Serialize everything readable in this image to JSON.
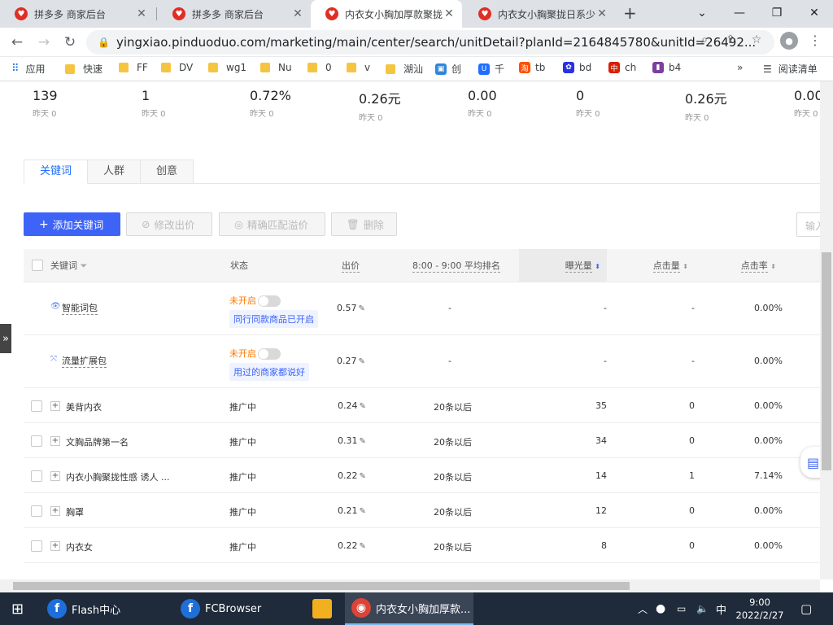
{
  "browser": {
    "tabs": [
      {
        "title": "拼多多 商家后台",
        "active": false
      },
      {
        "title": "拼多多 商家后台",
        "active": false
      },
      {
        "title": "内衣女小胸加厚款聚拢",
        "active": true
      },
      {
        "title": "内衣女小胸聚拢日系少",
        "active": false
      }
    ],
    "url": "yingxiao.pinduoduo.com/marketing/main/center/search/unitDetail?planId=2164845780&unitId=26492...",
    "bookmarks": [
      "应用",
      "快速",
      "FF",
      "DV",
      "wg1",
      "Nu",
      "0",
      "v",
      "湖汕",
      "创",
      "千",
      "tb",
      "bd",
      "ch",
      "b4"
    ],
    "reading_list": "阅读清单"
  },
  "metrics": [
    {
      "value": "139",
      "yesterday": "昨天 0"
    },
    {
      "value": "1",
      "yesterday": "昨天 0"
    },
    {
      "value": "0.72%",
      "yesterday": "昨天 0"
    },
    {
      "value": "0.26元",
      "yesterday": "昨天 0"
    },
    {
      "value": "0.00",
      "yesterday": "昨天 0"
    },
    {
      "value": "0",
      "yesterday": "昨天 0"
    },
    {
      "value": "0.26元",
      "yesterday": "昨天 0"
    },
    {
      "value": "0.00",
      "yesterday": "昨天 0"
    }
  ],
  "subtabs": [
    "关键词",
    "人群",
    "创意"
  ],
  "actions": {
    "add": "添加关键词",
    "edit_bid": "修改出价",
    "exact_match": "精确匹配溢价",
    "delete": "删除",
    "search_placeholder": "输入"
  },
  "table": {
    "headers": {
      "keyword": "关键词",
      "status": "状态",
      "bid": "出价",
      "rank": "8:00 - 9:00 平均排名",
      "impressions": "曝光量",
      "clicks": "点击量",
      "ctr": "点击率"
    },
    "special_rows": [
      {
        "name": "智能词包",
        "status": "未开启",
        "note": "同行同款商品已开启",
        "bid": "0.57",
        "rank": "-",
        "impressions": "-",
        "clicks": "-",
        "ctr": "0.00%"
      },
      {
        "name": "流量扩展包",
        "status": "未开启",
        "note": "用过的商家都说好",
        "bid": "0.27",
        "rank": "-",
        "impressions": "-",
        "clicks": "-",
        "ctr": "0.00%"
      }
    ],
    "rows": [
      {
        "keyword": "美背内衣",
        "status": "推广中",
        "bid": "0.24",
        "rank": "20条以后",
        "impressions": "35",
        "clicks": "0",
        "ctr": "0.00%"
      },
      {
        "keyword": "文胸品牌第一名",
        "status": "推广中",
        "bid": "0.31",
        "rank": "20条以后",
        "impressions": "34",
        "clicks": "0",
        "ctr": "0.00%"
      },
      {
        "keyword": "内衣小胸聚拢性感 诱人 ...",
        "status": "推广中",
        "bid": "0.22",
        "rank": "20条以后",
        "impressions": "14",
        "clicks": "1",
        "ctr": "7.14%"
      },
      {
        "keyword": "胸罩",
        "status": "推广中",
        "bid": "0.21",
        "rank": "20条以后",
        "impressions": "12",
        "clicks": "0",
        "ctr": "0.00%"
      },
      {
        "keyword": "内衣女",
        "status": "推广中",
        "bid": "0.22",
        "rank": "20条以后",
        "impressions": "8",
        "clicks": "0",
        "ctr": "0.00%"
      }
    ]
  },
  "taskbar": {
    "items": [
      "Flash中心",
      "FCBrowser",
      "内衣女小胸加厚款..."
    ],
    "ime": "中",
    "time": "9:00",
    "date": "2022/2/27"
  }
}
